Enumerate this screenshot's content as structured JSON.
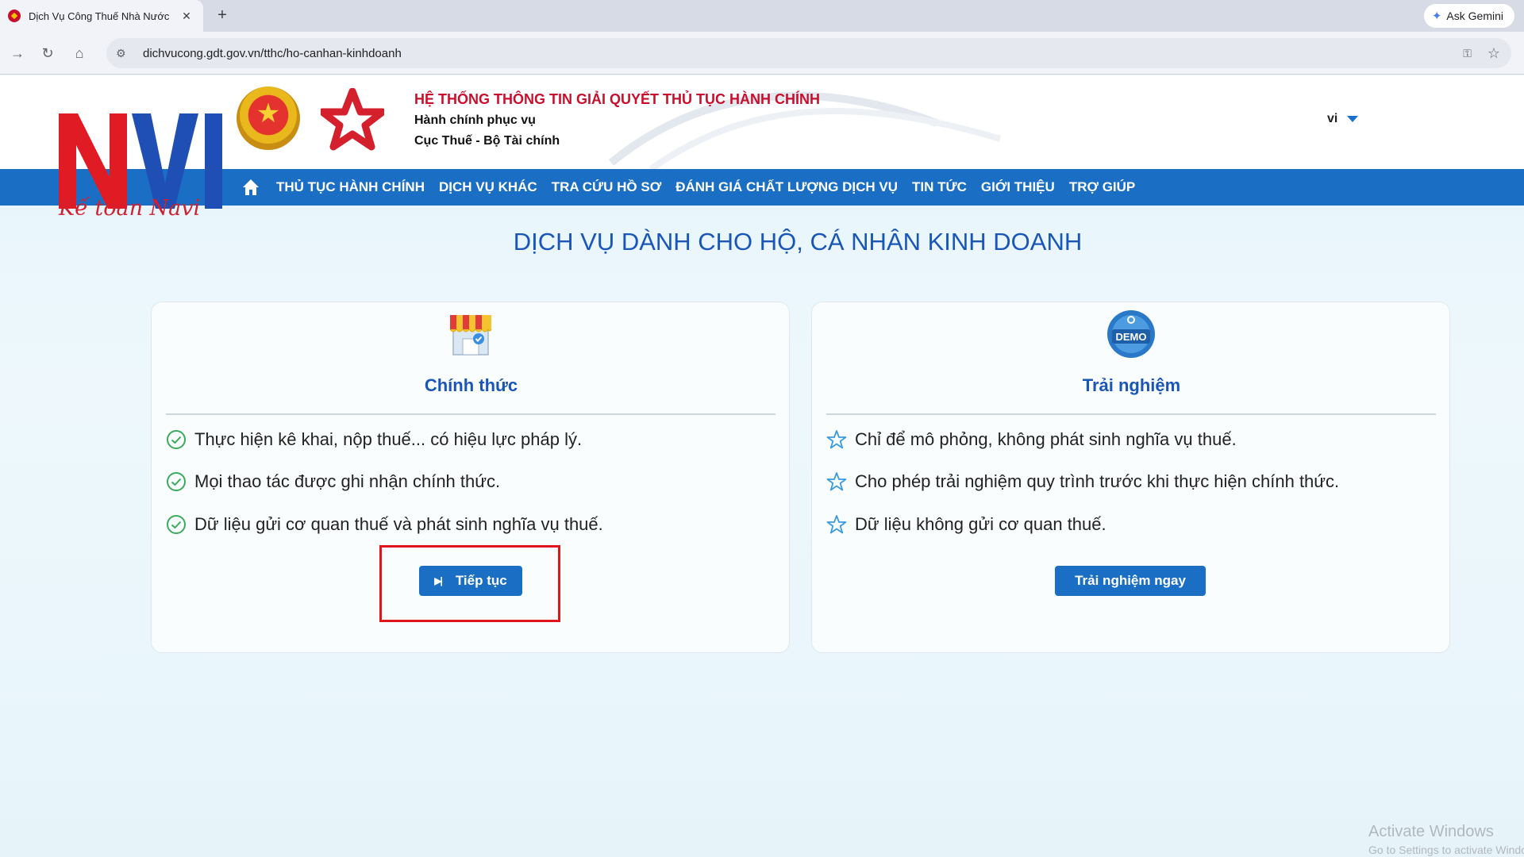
{
  "browser": {
    "tab_title": "Dịch Vụ Công Thuế Nhà Nước",
    "tab_close": "✕",
    "new_tab": "+",
    "ask_gemini": "Ask Gemini",
    "url": "dichvucong.gdt.gov.vn/tthc/ho-canhan-kinhdoanh"
  },
  "header": {
    "system_title": "HỆ THỐNG THÔNG TIN GIẢI QUYẾT THỦ TỤC HÀNH CHÍNH",
    "subtitle_1": "Hành chính phục vụ",
    "subtitle_2": "Cục Thuế - Bộ Tài chính",
    "language": "vi"
  },
  "nav": {
    "items": [
      "THỦ TỤC HÀNH CHÍNH",
      "DỊCH VỤ KHÁC",
      "TRA CỨU HỒ SƠ",
      "ĐÁNH GIÁ CHẤT LƯỢNG DỊCH VỤ",
      "TIN TỨC",
      "GIỚI THIỆU",
      "TRỢ GIÚP"
    ]
  },
  "overlay_logo": {
    "brand": "NAVI",
    "script": "Kế toán Navi"
  },
  "main": {
    "title": "DỊCH VỤ DÀNH CHO HỘ, CÁ NHÂN KINH DOANH",
    "official": {
      "title": "Chính thức",
      "features": [
        "Thực hiện kê khai, nộp thuế... có hiệu lực pháp lý.",
        "Mọi thao tác được ghi nhận chính thức.",
        "Dữ liệu gửi cơ quan thuế và phát sinh nghĩa vụ thuế."
      ],
      "button": "Tiếp tục"
    },
    "trial": {
      "title": "Trải nghiệm",
      "icon_text": "DEMO",
      "features": [
        "Chỉ để mô phỏng, không phát sinh nghĩa vụ thuế.",
        "Cho phép trải nghiệm quy trình trước khi thực hiện chính thức.",
        "Dữ liệu không gửi cơ quan thuế."
      ],
      "button": "Trải nghiệm ngay"
    }
  },
  "watermark": {
    "line1": "Activate Windows",
    "line2": "Go to Settings to activate Windows."
  },
  "colors": {
    "primary_blue": "#1a6fc4",
    "title_blue": "#1a56b8",
    "alert_red": "#c8102e",
    "highlight_red": "#e0141c",
    "check_green": "#3aaa5c"
  }
}
